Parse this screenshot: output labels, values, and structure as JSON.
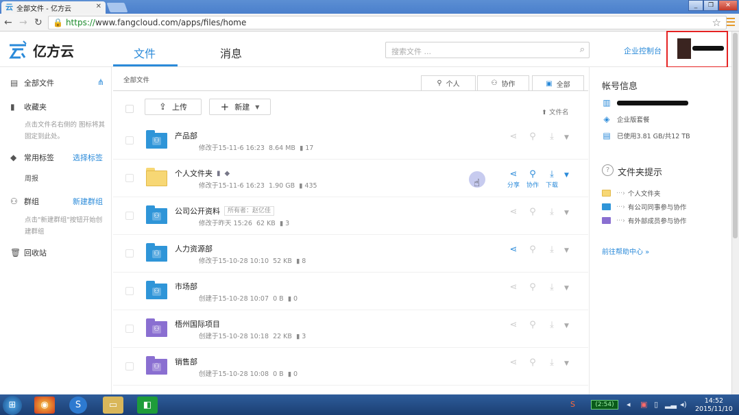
{
  "browser": {
    "tab_title": "全部文件 - 亿方云",
    "url_scheme": "https://",
    "url_rest": "www.fangcloud.com/apps/files/home"
  },
  "app": {
    "brand": "亿方云",
    "nav": {
      "files": "文件",
      "messages": "消息"
    },
    "search_placeholder": "搜索文件 ...",
    "console": "企业控制台"
  },
  "sidebar": {
    "all_files": "全部文件",
    "favorites": "收藏夹",
    "favorites_hint": "点击文件名右侧的 图标将其固定到此处。",
    "tags": "常用标签",
    "choose_tags": "选择标签",
    "tag_item": "周报",
    "groups": "群组",
    "new_group": "新建群组",
    "groups_hint": "点击\"新建群组\"按钮开始创建群组",
    "recycle": "回收站"
  },
  "main": {
    "breadcrumb": "全部文件",
    "scopes": [
      "个人",
      "协作",
      "全部"
    ],
    "upload": "上传",
    "create": "新建",
    "sort_label": "文件名",
    "rows": [
      {
        "name": "产品部",
        "meta": "修改于15-11-6 16:23",
        "size": "8.64 MB",
        "count": "17",
        "color": "blue"
      },
      {
        "name": "个人文件夹",
        "meta": "修改于15-11-6 16:23",
        "size": "1.90 GB",
        "count": "435",
        "color": "yellow"
      },
      {
        "name": "公司公开资料",
        "tag": "所有者：赵亿佳",
        "meta": "修改于昨天 15:26",
        "size": "62 KB",
        "count": "3",
        "color": "blue"
      },
      {
        "name": "人力资源部",
        "meta": "修改于15-10-28 10:10",
        "size": "52 KB",
        "count": "8",
        "color": "blue"
      },
      {
        "name": "市场部",
        "meta": "创建于15-10-28 10:07",
        "size": "0 B",
        "count": "0",
        "color": "blue"
      },
      {
        "name": "梧州国际项目",
        "meta": "创建于15-10-28 10:18",
        "size": "22 KB",
        "count": "3",
        "color": "purple"
      },
      {
        "name": "销售部",
        "meta": "创建于15-10-28 10:08",
        "size": "0 B",
        "count": "0",
        "color": "purple"
      }
    ],
    "actions": {
      "share": "分享",
      "collab": "协作",
      "download": "下载"
    }
  },
  "panel": {
    "account_title": "帐号信息",
    "plan": "企业版套餐",
    "usage": "已使用3.81 GB/共12 TB",
    "folder_tips_title": "文件夹提示",
    "tips": [
      "个人文件夹",
      "有公司同事参与协作",
      "有外部成员参与协作"
    ],
    "help": "前往帮助中心 »"
  },
  "taskbar": {
    "battery": "(2:54)",
    "time": "14:52",
    "date": "2015/11/10"
  },
  "colors": {
    "accent": "#2a8ad9",
    "folder_blue": "#2f95d8",
    "folder_yellow": "#f7d774",
    "folder_purple": "#8a6fd1",
    "annotation_red": "#e52222"
  }
}
